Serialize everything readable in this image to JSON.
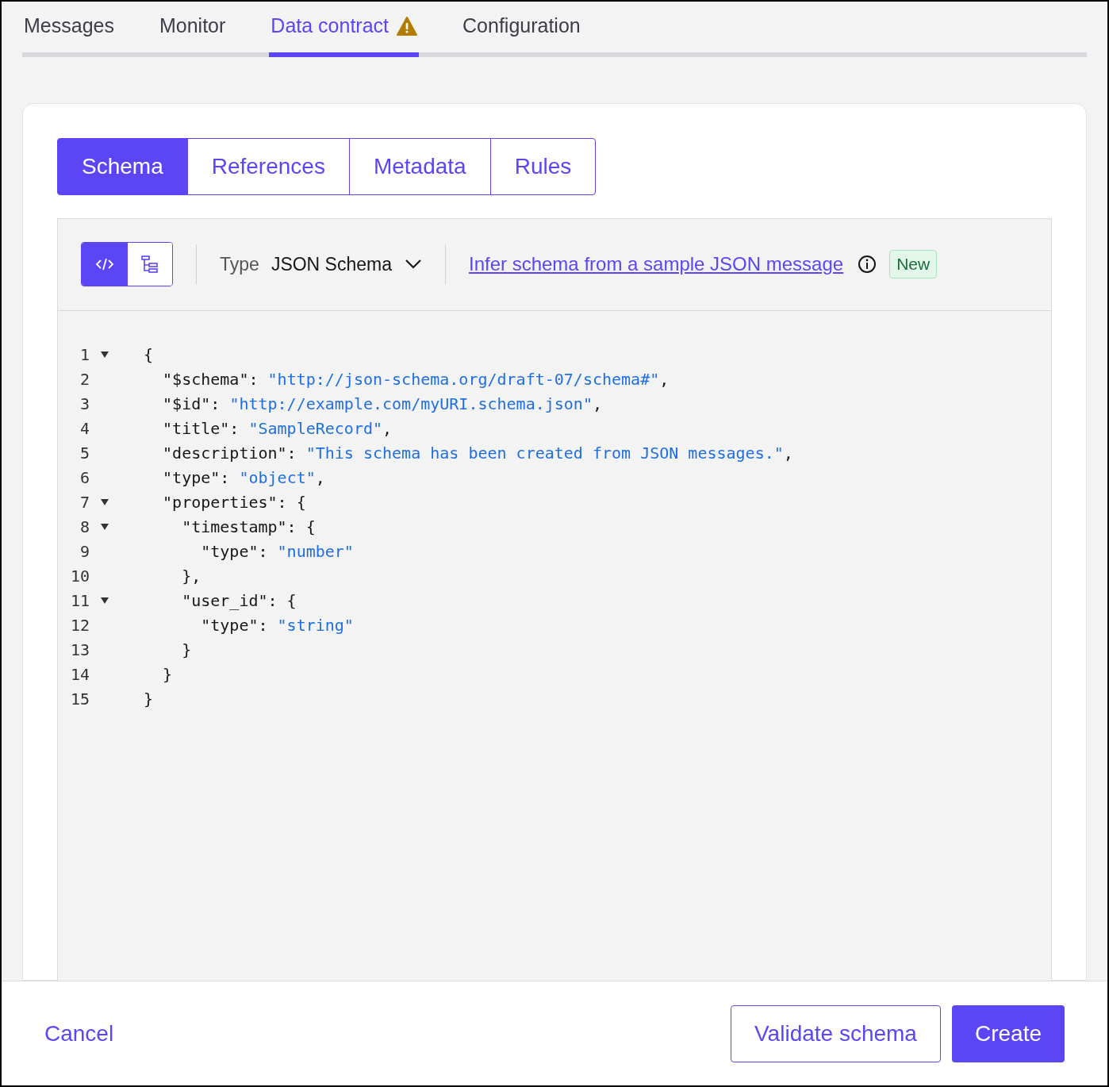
{
  "tabs": [
    {
      "label": "Messages",
      "selected": false,
      "warning": false
    },
    {
      "label": "Monitor",
      "selected": false,
      "warning": false
    },
    {
      "label": "Data contract",
      "selected": true,
      "warning": true
    },
    {
      "label": "Configuration",
      "selected": false,
      "warning": false
    }
  ],
  "sub_tabs": [
    {
      "label": "Schema",
      "selected": true
    },
    {
      "label": "References",
      "selected": false
    },
    {
      "label": "Metadata",
      "selected": false
    },
    {
      "label": "Rules",
      "selected": false
    }
  ],
  "editor": {
    "view_toggle": [
      {
        "kind": "code",
        "selected": true
      },
      {
        "kind": "tree",
        "selected": false
      }
    ],
    "type_label": "Type",
    "type_value": "JSON Schema",
    "infer_link": "Infer schema from a sample JSON message",
    "badge": "New",
    "lines": [
      {
        "number": "1",
        "foldable": true,
        "tokens": [
          {
            "kind": "plain",
            "text": "{"
          }
        ]
      },
      {
        "number": "2",
        "foldable": false,
        "tokens": [
          {
            "kind": "plain",
            "text": "  \"$schema\": "
          },
          {
            "kind": "string",
            "text": "\"http://json-schema.org/draft-07/schema#\""
          },
          {
            "kind": "plain",
            "text": ","
          }
        ]
      },
      {
        "number": "3",
        "foldable": false,
        "tokens": [
          {
            "kind": "plain",
            "text": "  \"$id\": "
          },
          {
            "kind": "string",
            "text": "\"http://example.com/myURI.schema.json\""
          },
          {
            "kind": "plain",
            "text": ","
          }
        ]
      },
      {
        "number": "4",
        "foldable": false,
        "tokens": [
          {
            "kind": "plain",
            "text": "  \"title\": "
          },
          {
            "kind": "string",
            "text": "\"SampleRecord\""
          },
          {
            "kind": "plain",
            "text": ","
          }
        ]
      },
      {
        "number": "5",
        "foldable": false,
        "tokens": [
          {
            "kind": "plain",
            "text": "  \"description\": "
          },
          {
            "kind": "string",
            "text": "\"This schema has been created from JSON messages.\""
          },
          {
            "kind": "plain",
            "text": ","
          }
        ]
      },
      {
        "number": "6",
        "foldable": false,
        "tokens": [
          {
            "kind": "plain",
            "text": "  \"type\": "
          },
          {
            "kind": "string",
            "text": "\"object\""
          },
          {
            "kind": "plain",
            "text": ","
          }
        ]
      },
      {
        "number": "7",
        "foldable": true,
        "tokens": [
          {
            "kind": "plain",
            "text": "  \"properties\": {"
          }
        ]
      },
      {
        "number": "8",
        "foldable": true,
        "tokens": [
          {
            "kind": "plain",
            "text": "    \"timestamp\": {"
          }
        ]
      },
      {
        "number": "9",
        "foldable": false,
        "tokens": [
          {
            "kind": "plain",
            "text": "      \"type\": "
          },
          {
            "kind": "string",
            "text": "\"number\""
          }
        ]
      },
      {
        "number": "10",
        "foldable": false,
        "tokens": [
          {
            "kind": "plain",
            "text": "    },"
          }
        ]
      },
      {
        "number": "11",
        "foldable": true,
        "tokens": [
          {
            "kind": "plain",
            "text": "    \"user_id\": {"
          }
        ]
      },
      {
        "number": "12",
        "foldable": false,
        "tokens": [
          {
            "kind": "plain",
            "text": "      \"type\": "
          },
          {
            "kind": "string",
            "text": "\"string\""
          }
        ]
      },
      {
        "number": "13",
        "foldable": false,
        "tokens": [
          {
            "kind": "plain",
            "text": "    }"
          }
        ]
      },
      {
        "number": "14",
        "foldable": false,
        "tokens": [
          {
            "kind": "plain",
            "text": "  }"
          }
        ]
      },
      {
        "number": "15",
        "foldable": false,
        "tokens": [
          {
            "kind": "plain",
            "text": "}"
          }
        ]
      }
    ]
  },
  "footer": {
    "cancel": "Cancel",
    "validate": "Validate schema",
    "create": "Create"
  }
}
